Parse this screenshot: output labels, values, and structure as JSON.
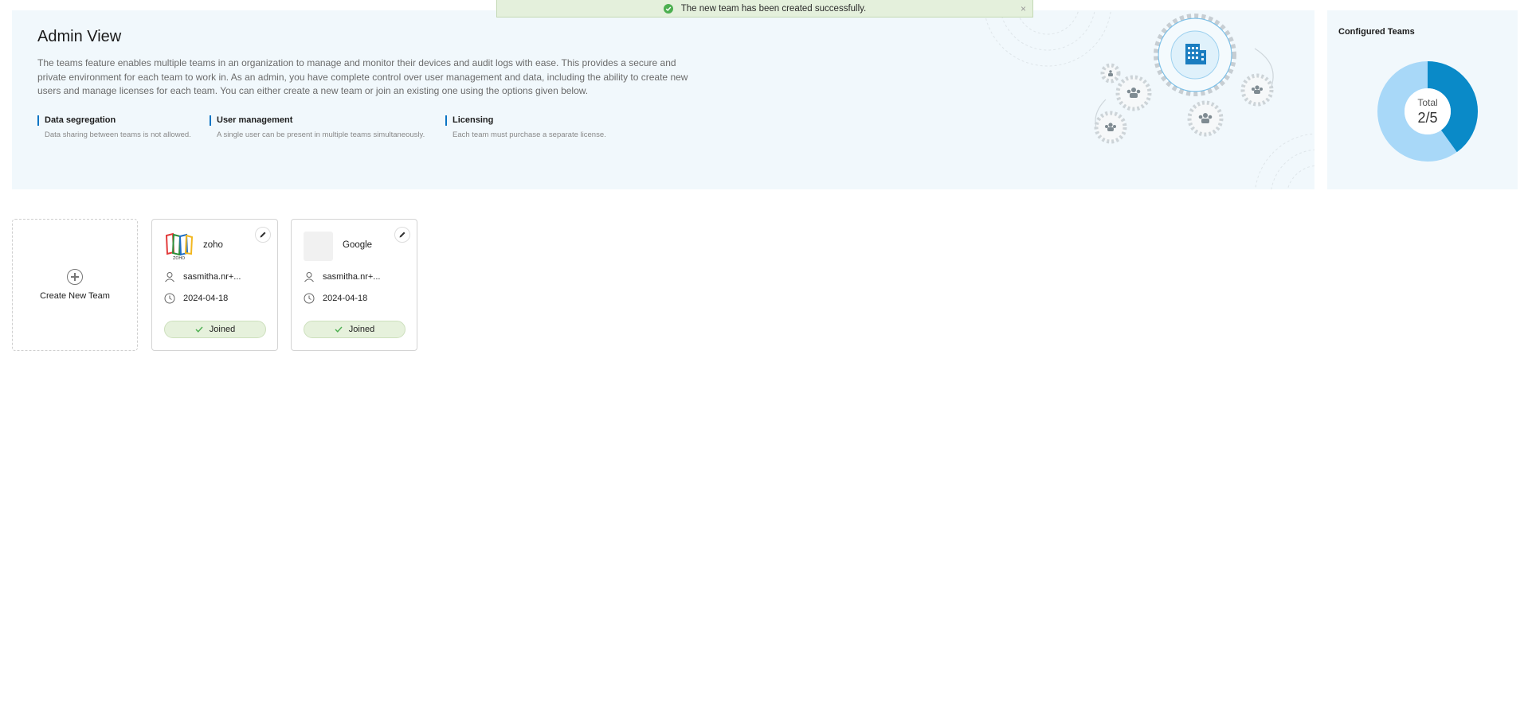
{
  "toast": {
    "message": "The new team has been created successfully.",
    "close": "×",
    "color": "#4caf50"
  },
  "hero": {
    "title": "Admin View",
    "description": "The teams feature enables multiple teams in an organization to manage and monitor their devices and audit logs with ease. This provides a secure and private environment for each team to work in. As an admin, you have complete control over user management and data, including the ability to create new users and manage licenses for each team. You can either create a new team or join an existing one using the options given below.",
    "features": [
      {
        "title": "Data segregation",
        "desc": "Data sharing between teams is not allowed."
      },
      {
        "title": "User management",
        "desc": "A single user can be present in multiple teams simultaneously."
      },
      {
        "title": "Licensing",
        "desc": "Each team must purchase a separate license."
      }
    ]
  },
  "configured": {
    "title": "Configured Teams",
    "total_label": "Total",
    "total_value": "2/5",
    "configured_count": 2,
    "max_count": 5,
    "colors": {
      "configured": "#0a8ac8",
      "remaining": "#a8d8f8"
    }
  },
  "create": {
    "label": "Create New Team"
  },
  "teams": [
    {
      "name": "zoho",
      "owner": "sasmitha.nr+...",
      "date": "2024-04-18",
      "status": "Joined",
      "logo": "zoho-logo"
    },
    {
      "name": "Google",
      "owner": "sasmitha.nr+...",
      "date": "2024-04-18",
      "status": "Joined",
      "logo": "placeholder-logo"
    }
  ]
}
